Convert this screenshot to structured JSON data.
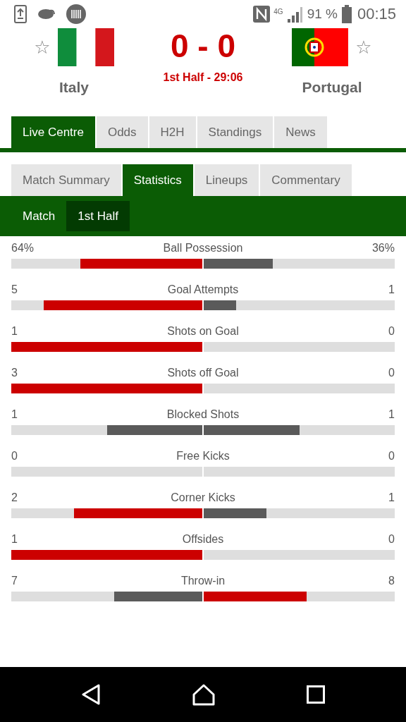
{
  "status_bar": {
    "network": "4G",
    "battery": "91 %",
    "time": "00:15"
  },
  "match": {
    "home": {
      "name": "Italy",
      "star": "☆"
    },
    "away": {
      "name": "Portugal",
      "star": "☆"
    },
    "score": "0 - 0",
    "period": "1st Half - 29:06"
  },
  "tabs": [
    {
      "label": "Live Centre",
      "selected": true
    },
    {
      "label": "Odds",
      "selected": false
    },
    {
      "label": "H2H",
      "selected": false
    },
    {
      "label": "Standings",
      "selected": false
    },
    {
      "label": "News",
      "selected": false
    }
  ],
  "sub_tabs": [
    {
      "label": "Match Summary",
      "selected": false
    },
    {
      "label": "Statistics",
      "selected": true
    },
    {
      "label": "Lineups",
      "selected": false
    },
    {
      "label": "Commentary",
      "selected": false
    }
  ],
  "periods": [
    {
      "label": "Match",
      "selected": false
    },
    {
      "label": "1st Half",
      "selected": true
    }
  ],
  "statistics": [
    {
      "name": "Ball Possession",
      "home": {
        "value": "64%",
        "level": 0.64
      },
      "away": {
        "value": "36%",
        "level": 0.36
      }
    },
    {
      "name": "Goal Attempts",
      "home": {
        "value": "5",
        "level": 0.83
      },
      "away": {
        "value": "1",
        "level": 0.17
      }
    },
    {
      "name": "Shots on Goal",
      "home": {
        "value": "1",
        "level": 1
      },
      "away": {
        "value": "0",
        "level": 0
      }
    },
    {
      "name": "Shots off Goal",
      "home": {
        "value": "3",
        "level": 1
      },
      "away": {
        "value": "0",
        "level": 0
      }
    },
    {
      "name": "Blocked Shots",
      "home": {
        "value": "1",
        "level": 0.5
      },
      "away": {
        "value": "1",
        "level": 0.5
      }
    },
    {
      "name": "Free Kicks",
      "home": {
        "value": "0",
        "level": 0
      },
      "away": {
        "value": "0",
        "level": 0
      }
    },
    {
      "name": "Corner Kicks",
      "home": {
        "value": "2",
        "level": 0.67
      },
      "away": {
        "value": "1",
        "level": 0.33
      }
    },
    {
      "name": "Offsides",
      "home": {
        "value": "1",
        "level": 1
      },
      "away": {
        "value": "0",
        "level": 0
      }
    },
    {
      "name": "Throw-in",
      "home": {
        "value": "7",
        "level": 0.46
      },
      "away": {
        "value": "8",
        "level": 0.54
      }
    }
  ]
}
